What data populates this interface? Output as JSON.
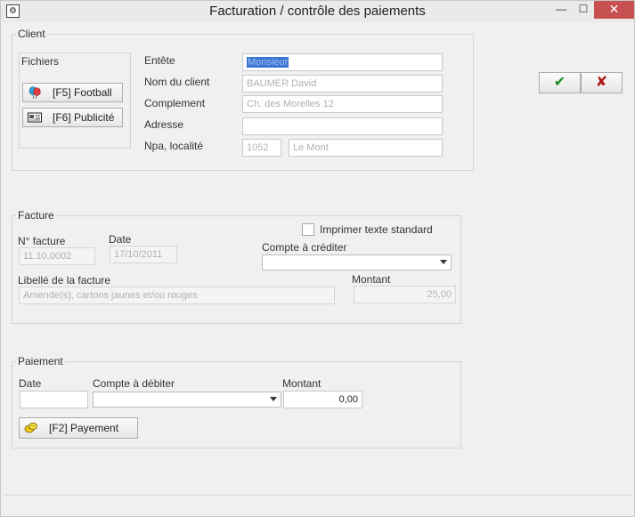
{
  "window": {
    "title": "Facturation / contrôle des paiements",
    "min_glyph": "—",
    "max_glyph": "☐",
    "close_glyph": "✕"
  },
  "client": {
    "legend": "Client",
    "fichiers_legend": "Fichiers",
    "football_button": "[F5] Football",
    "publicite_button": "[F6] Publicité",
    "labels": {
      "entete": "Entête",
      "nom_client": "Nom du client",
      "complement": "Complement",
      "adresse": "Adresse",
      "npa_localite": "Npa, localité"
    },
    "values": {
      "entete": "Monsieur",
      "nom_client": "BAUMER David",
      "complement": "Ch. des Morelles 12",
      "adresse": "",
      "npa": "1052",
      "localite": "Le Mont"
    }
  },
  "actions": {
    "ok_glyph": "✔",
    "cancel_glyph": "✘"
  },
  "facture": {
    "legend": "Facture",
    "imprimer_label": "Imprimer texte standard",
    "no_facture_label": "N° facture",
    "date_label": "Date",
    "compte_crediter_label": "Compte à créditer",
    "libelle_label": "Libellé de la facture",
    "montant_label": "Montant",
    "no_facture_value": "11.10.0002",
    "date_value": "17/10/2011",
    "libelle_value": "Amende(s), cartons jaunes et/ou rouges",
    "montant_value": "25,00",
    "compte_crediter_value": ""
  },
  "paiement": {
    "legend": "Paiement",
    "date_label": "Date",
    "compte_debiter_label": "Compte à débiter",
    "montant_label": "Montant",
    "date_value": "",
    "compte_debiter_value": "",
    "montant_value": "0,00",
    "payement_button": "[F2] Payement"
  }
}
